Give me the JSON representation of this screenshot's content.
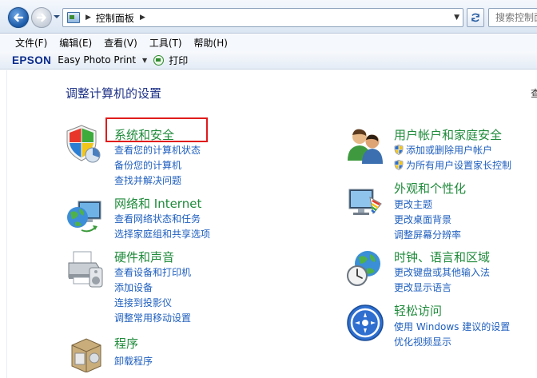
{
  "address_bar": {
    "breadcrumb": [
      "控制面板"
    ],
    "search_placeholder": "搜索控制面板"
  },
  "menu": {
    "items": [
      "文件(F)",
      "编辑(E)",
      "查看(V)",
      "工具(T)",
      "帮助(H)"
    ]
  },
  "toolbar": {
    "brand": "EPSON",
    "app": "Easy Photo Print",
    "print": "打印"
  },
  "main": {
    "title": "调整计算机的设置",
    "view_by_clip": "查",
    "left_categories": [
      {
        "title": "系统和安全",
        "links": [
          "查看您的计算机状态",
          "备份您的计算机",
          "查找并解决问题"
        ]
      },
      {
        "title": "网络和 Internet",
        "links": [
          "查看网络状态和任务",
          "选择家庭组和共享选项"
        ]
      },
      {
        "title": "硬件和声音",
        "links": [
          "查看设备和打印机",
          "添加设备",
          "连接到投影仪",
          "调整常用移动设置"
        ]
      },
      {
        "title": "程序",
        "links": [
          "卸载程序"
        ]
      }
    ],
    "right_categories": [
      {
        "title": "用户帐户和家庭安全",
        "links": [
          "添加或删除用户帐户",
          "为所有用户设置家长控制"
        ]
      },
      {
        "title": "外观和个性化",
        "links": [
          "更改主题",
          "更改桌面背景",
          "调整屏幕分辨率"
        ]
      },
      {
        "title": "时钟、语言和区域",
        "links": [
          "更改键盘或其他输入法",
          "更改显示语言"
        ]
      },
      {
        "title": "轻松访问",
        "links": [
          "使用 Windows 建议的设置",
          "优化视频显示"
        ]
      }
    ]
  },
  "icons": {
    "back": "back-arrow-icon",
    "forward": "forward-arrow-icon",
    "control_panel": "control-panel-icon",
    "refresh": "refresh-icon",
    "print": "print-icon",
    "system_security": "shield-icon",
    "network": "globe-network-icon",
    "hardware": "printer-icon",
    "programs": "programs-box-icon",
    "user_accounts": "users-icon",
    "appearance": "monitor-paint-icon",
    "clock_region": "clock-globe-icon",
    "ease_of_access": "ease-of-access-icon"
  },
  "colors": {
    "category_title": "#1e8a3a",
    "link": "#1f5fbf",
    "page_title": "#1e3287",
    "highlight": "#e01b1b"
  }
}
